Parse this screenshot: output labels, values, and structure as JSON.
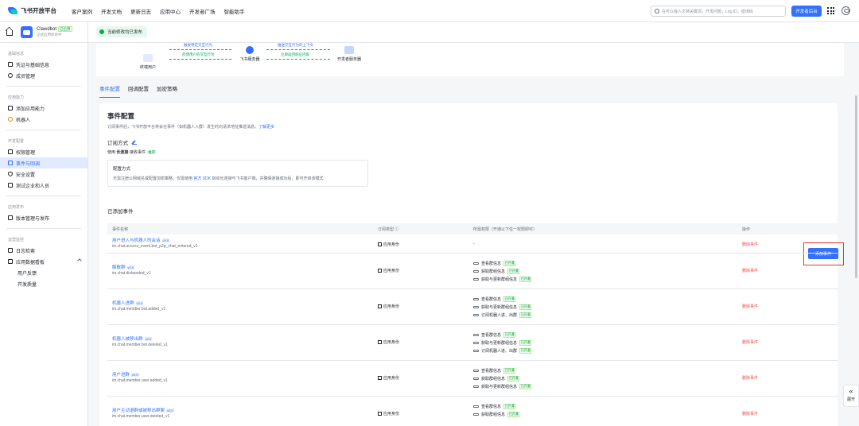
{
  "header": {
    "logo_text": "飞书开放平台",
    "nav": [
      "客户案例",
      "开发文档",
      "更新日志",
      "应用中心",
      "开发者广场",
      "智能助手"
    ],
    "search_placeholder": "在可以输入文档关键词，开发问题，Log ID，错误码",
    "console_label": "开发者后台"
  },
  "sidebar": {
    "app_name": "Clawdbot",
    "app_tag": "已启用",
    "app_sub": "正式应用体验中",
    "sections": [
      {
        "title": "基础信息",
        "items": [
          "凭证与基础信息",
          "成员管理"
        ]
      },
      {
        "title": "应用能力",
        "items": [
          "添加应用能力",
          "机器人"
        ]
      },
      {
        "title": "开发配置",
        "items": [
          "权限管理",
          "事件与回调",
          "安全设置",
          "测试企业和人员"
        ]
      },
      {
        "title": "应用发布",
        "items": [
          "版本管理与发布"
        ]
      },
      {
        "title": "运营监控",
        "items": [
          "日志检索",
          "应用数据看板"
        ]
      }
    ],
    "sub_items": [
      "用户反馈",
      "开发质量"
    ],
    "active_item": "事件与回调"
  },
  "publish": {
    "status": "当前修改均已发布"
  },
  "flow": {
    "node_user": "终端用户",
    "node_server": "飞书服务器",
    "node_dev": "开发者服务器",
    "label_1": "触发特定交互行为",
    "label_2": "反馈用户的交互行为",
    "label_3": "推送交互行为的上下文",
    "label_4": "立即返回响应内容"
  },
  "tabs": [
    "事件配置",
    "回调配置",
    "加密策略"
  ],
  "event_config": {
    "title": "事件配置",
    "desc": "订阅事件后，飞书开放平台将会在事件（如机器人入群）发生时向请求地址推送消息。",
    "desc_link": "了解更多",
    "sub_title": "订阅方式",
    "sub_mode_prefix": "使用",
    "sub_mode_strong": "长连接",
    "sub_mode_suffix": "接收事件",
    "sub_mode_tag": "推荐",
    "cfg_title": "配置方式",
    "cfg_text_1": "无需注册公网域名或配置加密策略，仅需使用",
    "cfg_link": "官方 SDK",
    "cfg_text_2": "启动长连接与飞书客户端，并确保连接成功后，即可开启该模式",
    "added_title": "已添加事件",
    "add_button": "添加事件"
  },
  "table": {
    "headers": [
      "事件名称",
      "订阅类型 ⓘ",
      "所需权限（开通以下任一权限即可）",
      "操作"
    ],
    "version_tag": "v2.0",
    "type_label": "应用身份",
    "delete_label": "删除事件",
    "perm_on": "已开通",
    "rows": [
      {
        "name": "用户进入与机器人的会话",
        "key": "im.chat.access_event.bot_p2p_chat_entered_v1",
        "perms": [
          "-"
        ]
      },
      {
        "name": "解散群",
        "key": "im.chat.disbanded_v1",
        "perms": [
          "查看群信息",
          "获取群组信息",
          "获取与更新群组信息"
        ]
      },
      {
        "name": "机器人进群",
        "key": "im.chat.member.bot.added_v1",
        "perms": [
          "查看群信息",
          "获取与更新群组信息",
          "订阅机器人进、出群"
        ]
      },
      {
        "name": "机器人被移出群",
        "key": "im.chat.member.bot.deleted_v1",
        "perms": [
          "查看群信息",
          "获取与更新群组信息",
          "订阅机器人进、出群"
        ]
      },
      {
        "name": "用户进群",
        "key": "im.chat.member.user.added_v1",
        "perms": [
          "查看群信息",
          "获取群组信息",
          "获取与更新群组信息"
        ]
      },
      {
        "name": "用户主动退群或被移出群聊",
        "key": "im.chat.member.user.deleted_v1",
        "perms": [
          "查看群信息",
          "获取群组信息"
        ]
      }
    ]
  },
  "expand_label": "展开",
  "colors": {
    "brand": "#3370ff",
    "success": "#00b341",
    "danger": "#f54a45",
    "highlight_border": "#e03a3a"
  }
}
